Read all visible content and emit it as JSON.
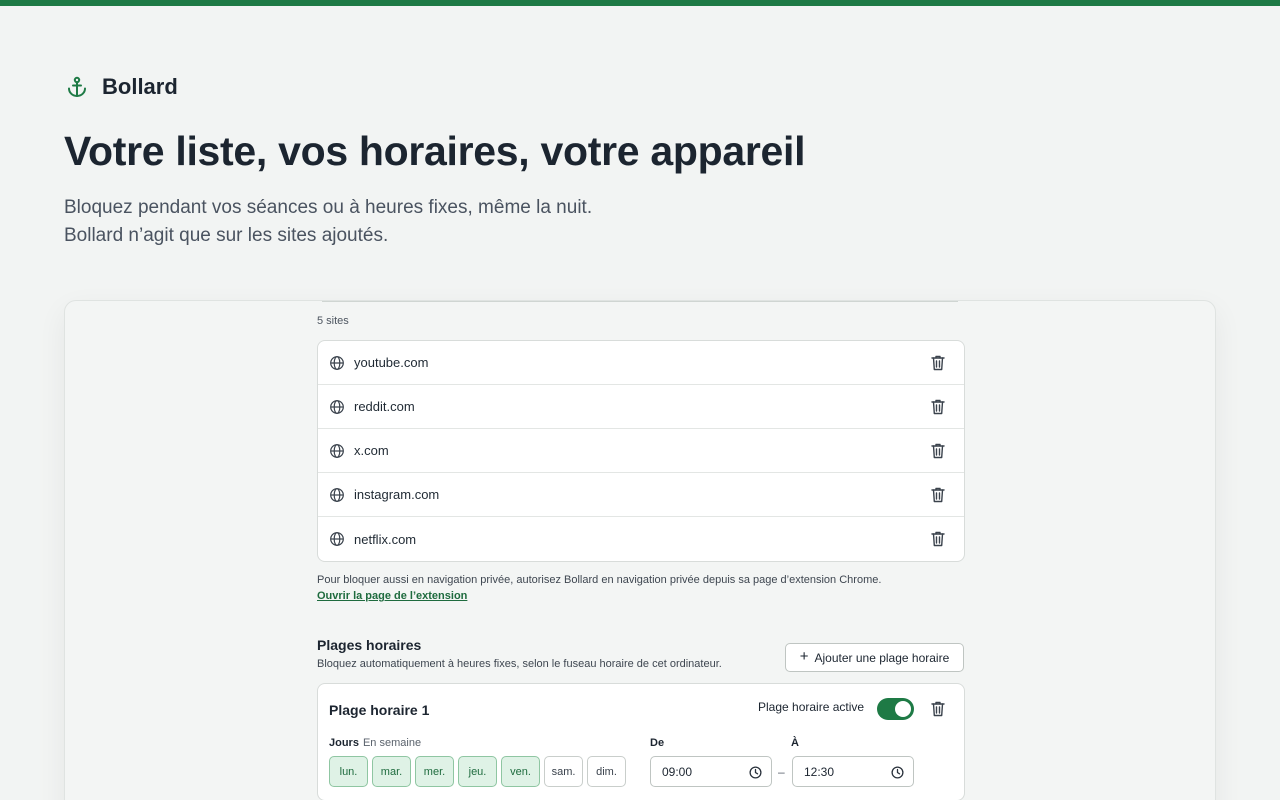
{
  "brand": {
    "name": "Bollard",
    "logo_icon": "anchor-icon",
    "accent": "#1e7a45"
  },
  "hero": {
    "title": "Votre liste, vos horaires, votre appareil",
    "subtitle_line1": "Bloquez pendant vos séances ou à heures fixes, même la nuit.",
    "subtitle_line2": "Bollard n’agit que sur les sites ajoutés."
  },
  "sites": {
    "count_label": "5 sites",
    "items": [
      {
        "domain": "youtube.com"
      },
      {
        "domain": "reddit.com"
      },
      {
        "domain": "x.com"
      },
      {
        "domain": "instagram.com"
      },
      {
        "domain": "netflix.com"
      }
    ]
  },
  "incognito": {
    "note": "Pour bloquer aussi en navigation privée, autorisez Bollard en navigation privée depuis sa page d’extension Chrome.",
    "link": "Ouvrir la page de l’extension"
  },
  "schedules": {
    "title": "Plages horaires",
    "subtitle": "Bloquez automatiquement à heures fixes, selon le fuseau horaire de cet ordinateur.",
    "add_button": "Ajouter une plage horaire",
    "items": [
      {
        "name": "Plage horaire 1",
        "active_label": "Plage horaire active",
        "active": true,
        "days_label": "Jours",
        "days_hint": "En semaine",
        "days": [
          {
            "label": "lun.",
            "selected": true
          },
          {
            "label": "mar.",
            "selected": true
          },
          {
            "label": "mer.",
            "selected": true
          },
          {
            "label": "jeu.",
            "selected": true
          },
          {
            "label": "ven.",
            "selected": true
          },
          {
            "label": "sam.",
            "selected": false
          },
          {
            "label": "dim.",
            "selected": false
          }
        ],
        "from_label": "De",
        "from": "09:00",
        "separator": "–",
        "to_label": "À",
        "to": "12:30"
      }
    ]
  }
}
